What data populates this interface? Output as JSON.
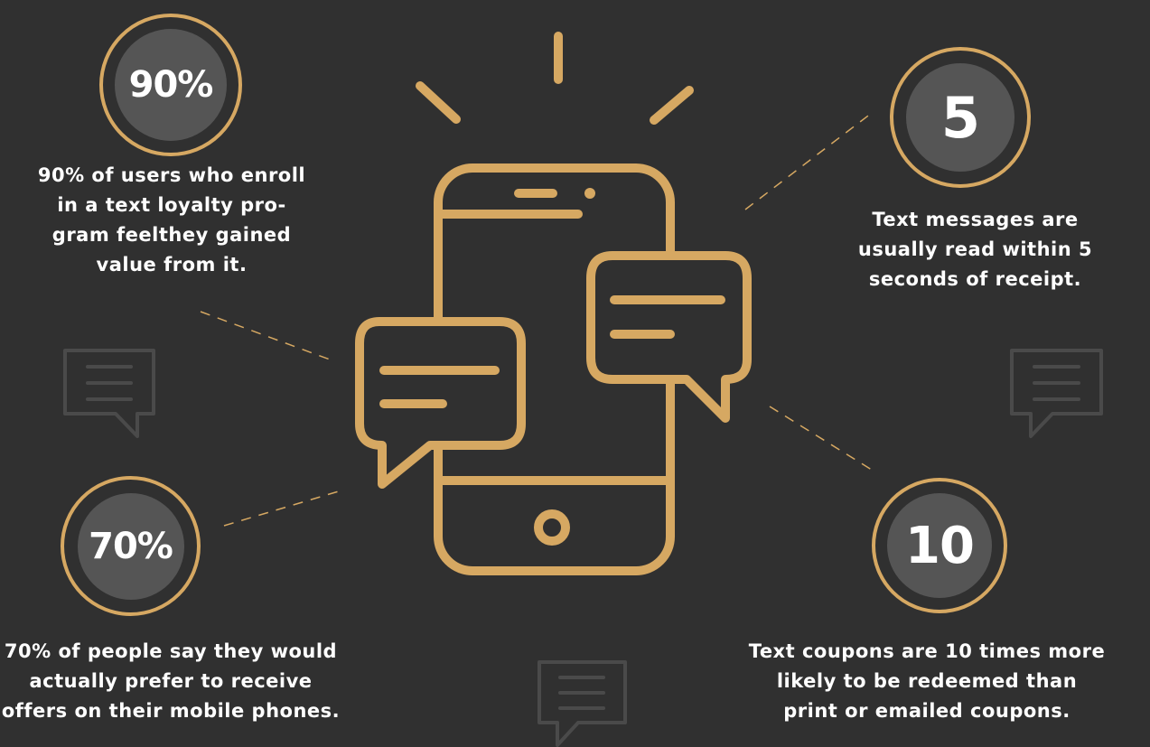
{
  "colors": {
    "background": "#303030",
    "accent": "#d6a862",
    "circle_fill": "#555555",
    "faint_icon": "#4a4a4a",
    "text": "#ffffff"
  },
  "icons": [
    "smartphone-icon",
    "chat-bubble-icon",
    "faint-message-icon",
    "radiating-rays"
  ],
  "stats": {
    "top_left": {
      "value": "90%",
      "caption_lines": [
        "90% of users who enroll",
        "in a text loyalty pro-",
        "gram feelthey gained",
        "value from it."
      ]
    },
    "top_right": {
      "value": "5",
      "caption_lines": [
        "Text messages are",
        "usually read within 5",
        "seconds of receipt."
      ]
    },
    "bottom_left": {
      "value": "70%",
      "caption_lines": [
        "70% of people say they would",
        "actually prefer to receive",
        "offers on their mobile phones."
      ]
    },
    "bottom_right": {
      "value": "10",
      "caption_lines": [
        "Text coupons are 10 times more",
        "likely to be redeemed than",
        "print or emailed coupons."
      ]
    }
  }
}
